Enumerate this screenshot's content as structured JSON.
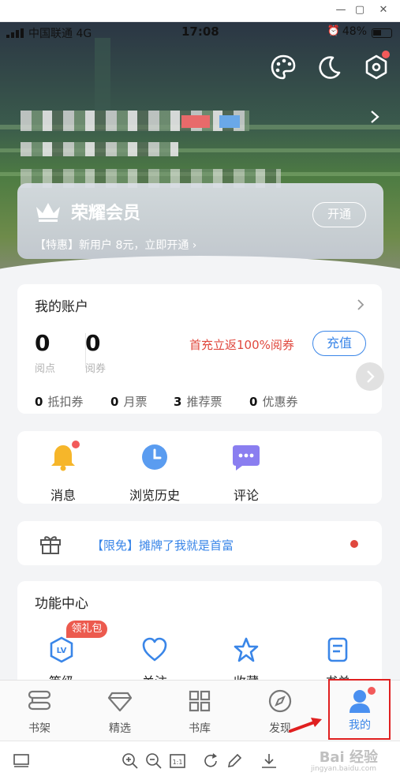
{
  "status_bar": {
    "carrier": "中国联通 4G",
    "time": "17:08",
    "battery": "48%"
  },
  "vip": {
    "title": "荣耀会员",
    "subtitle": "【特惠】新用户 8元，立即开通 ›",
    "open_button": "开通"
  },
  "account": {
    "title": "我的账户",
    "read_points": {
      "value": "0",
      "label": "阅点"
    },
    "read_vouchers": {
      "value": "0",
      "label": "阅券"
    },
    "promo": "首充立返100%阅券",
    "recharge_button": "充值",
    "vouchers": [
      {
        "count": "0",
        "label": "抵扣券"
      },
      {
        "count": "0",
        "label": "月票"
      },
      {
        "count": "3",
        "label": "推荐票"
      },
      {
        "count": "0",
        "label": "优惠券"
      }
    ]
  },
  "quick_actions": [
    {
      "label": "消息",
      "icon": "bell-icon"
    },
    {
      "label": "浏览历史",
      "icon": "clock-icon"
    },
    {
      "label": "评论",
      "icon": "comment-icon"
    }
  ],
  "notice": {
    "text": "【限免】摊牌了我就是首富"
  },
  "function_center": {
    "title": "功能中心",
    "badge": "领礼包",
    "items": [
      {
        "label": "等级",
        "icon": "level-icon"
      },
      {
        "label": "关注",
        "icon": "heart-icon"
      },
      {
        "label": "收藏",
        "icon": "star-icon"
      },
      {
        "label": "书单",
        "icon": "booklist-icon"
      }
    ]
  },
  "tabs": [
    {
      "label": "书架",
      "icon": "bookshelf-icon"
    },
    {
      "label": "精选",
      "icon": "diamond-icon"
    },
    {
      "label": "书库",
      "icon": "grid-icon"
    },
    {
      "label": "发现",
      "icon": "compass-icon"
    },
    {
      "label": "我的",
      "icon": "profile-icon",
      "active": true
    }
  ],
  "watermark": {
    "text": "Bai 经验",
    "sub": "jingyan.baidu.com"
  },
  "colors": {
    "accent": "#3a86e8",
    "promo_red": "#e0483e",
    "highlight": "#e02020"
  }
}
